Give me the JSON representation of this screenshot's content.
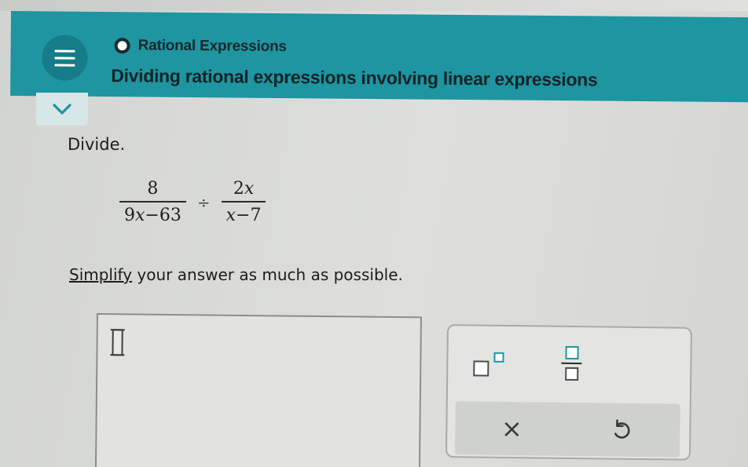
{
  "header": {
    "topic": "Rational Expressions",
    "title": "Dividing rational expressions involving linear expressions"
  },
  "problem": {
    "prompt": "Divide.",
    "expression": {
      "left_numerator": "8",
      "left_denominator": [
        "9",
        "x",
        "−63"
      ],
      "operator": "÷",
      "right_numerator": [
        "2",
        "x"
      ],
      "right_denominator": [
        "x",
        "−7"
      ]
    },
    "instruction_link": "Simplify",
    "instruction_rest": " your answer as much as possible."
  },
  "answer": {
    "value": ""
  },
  "keypad": {
    "exponent_key": "exponent-template",
    "fraction_key": "fraction-template",
    "clear_label": "×",
    "undo_key": "undo-icon"
  },
  "colors": {
    "accent": "#1e95a1",
    "header_dark": "#167c87",
    "text": "#1c1d1c"
  }
}
